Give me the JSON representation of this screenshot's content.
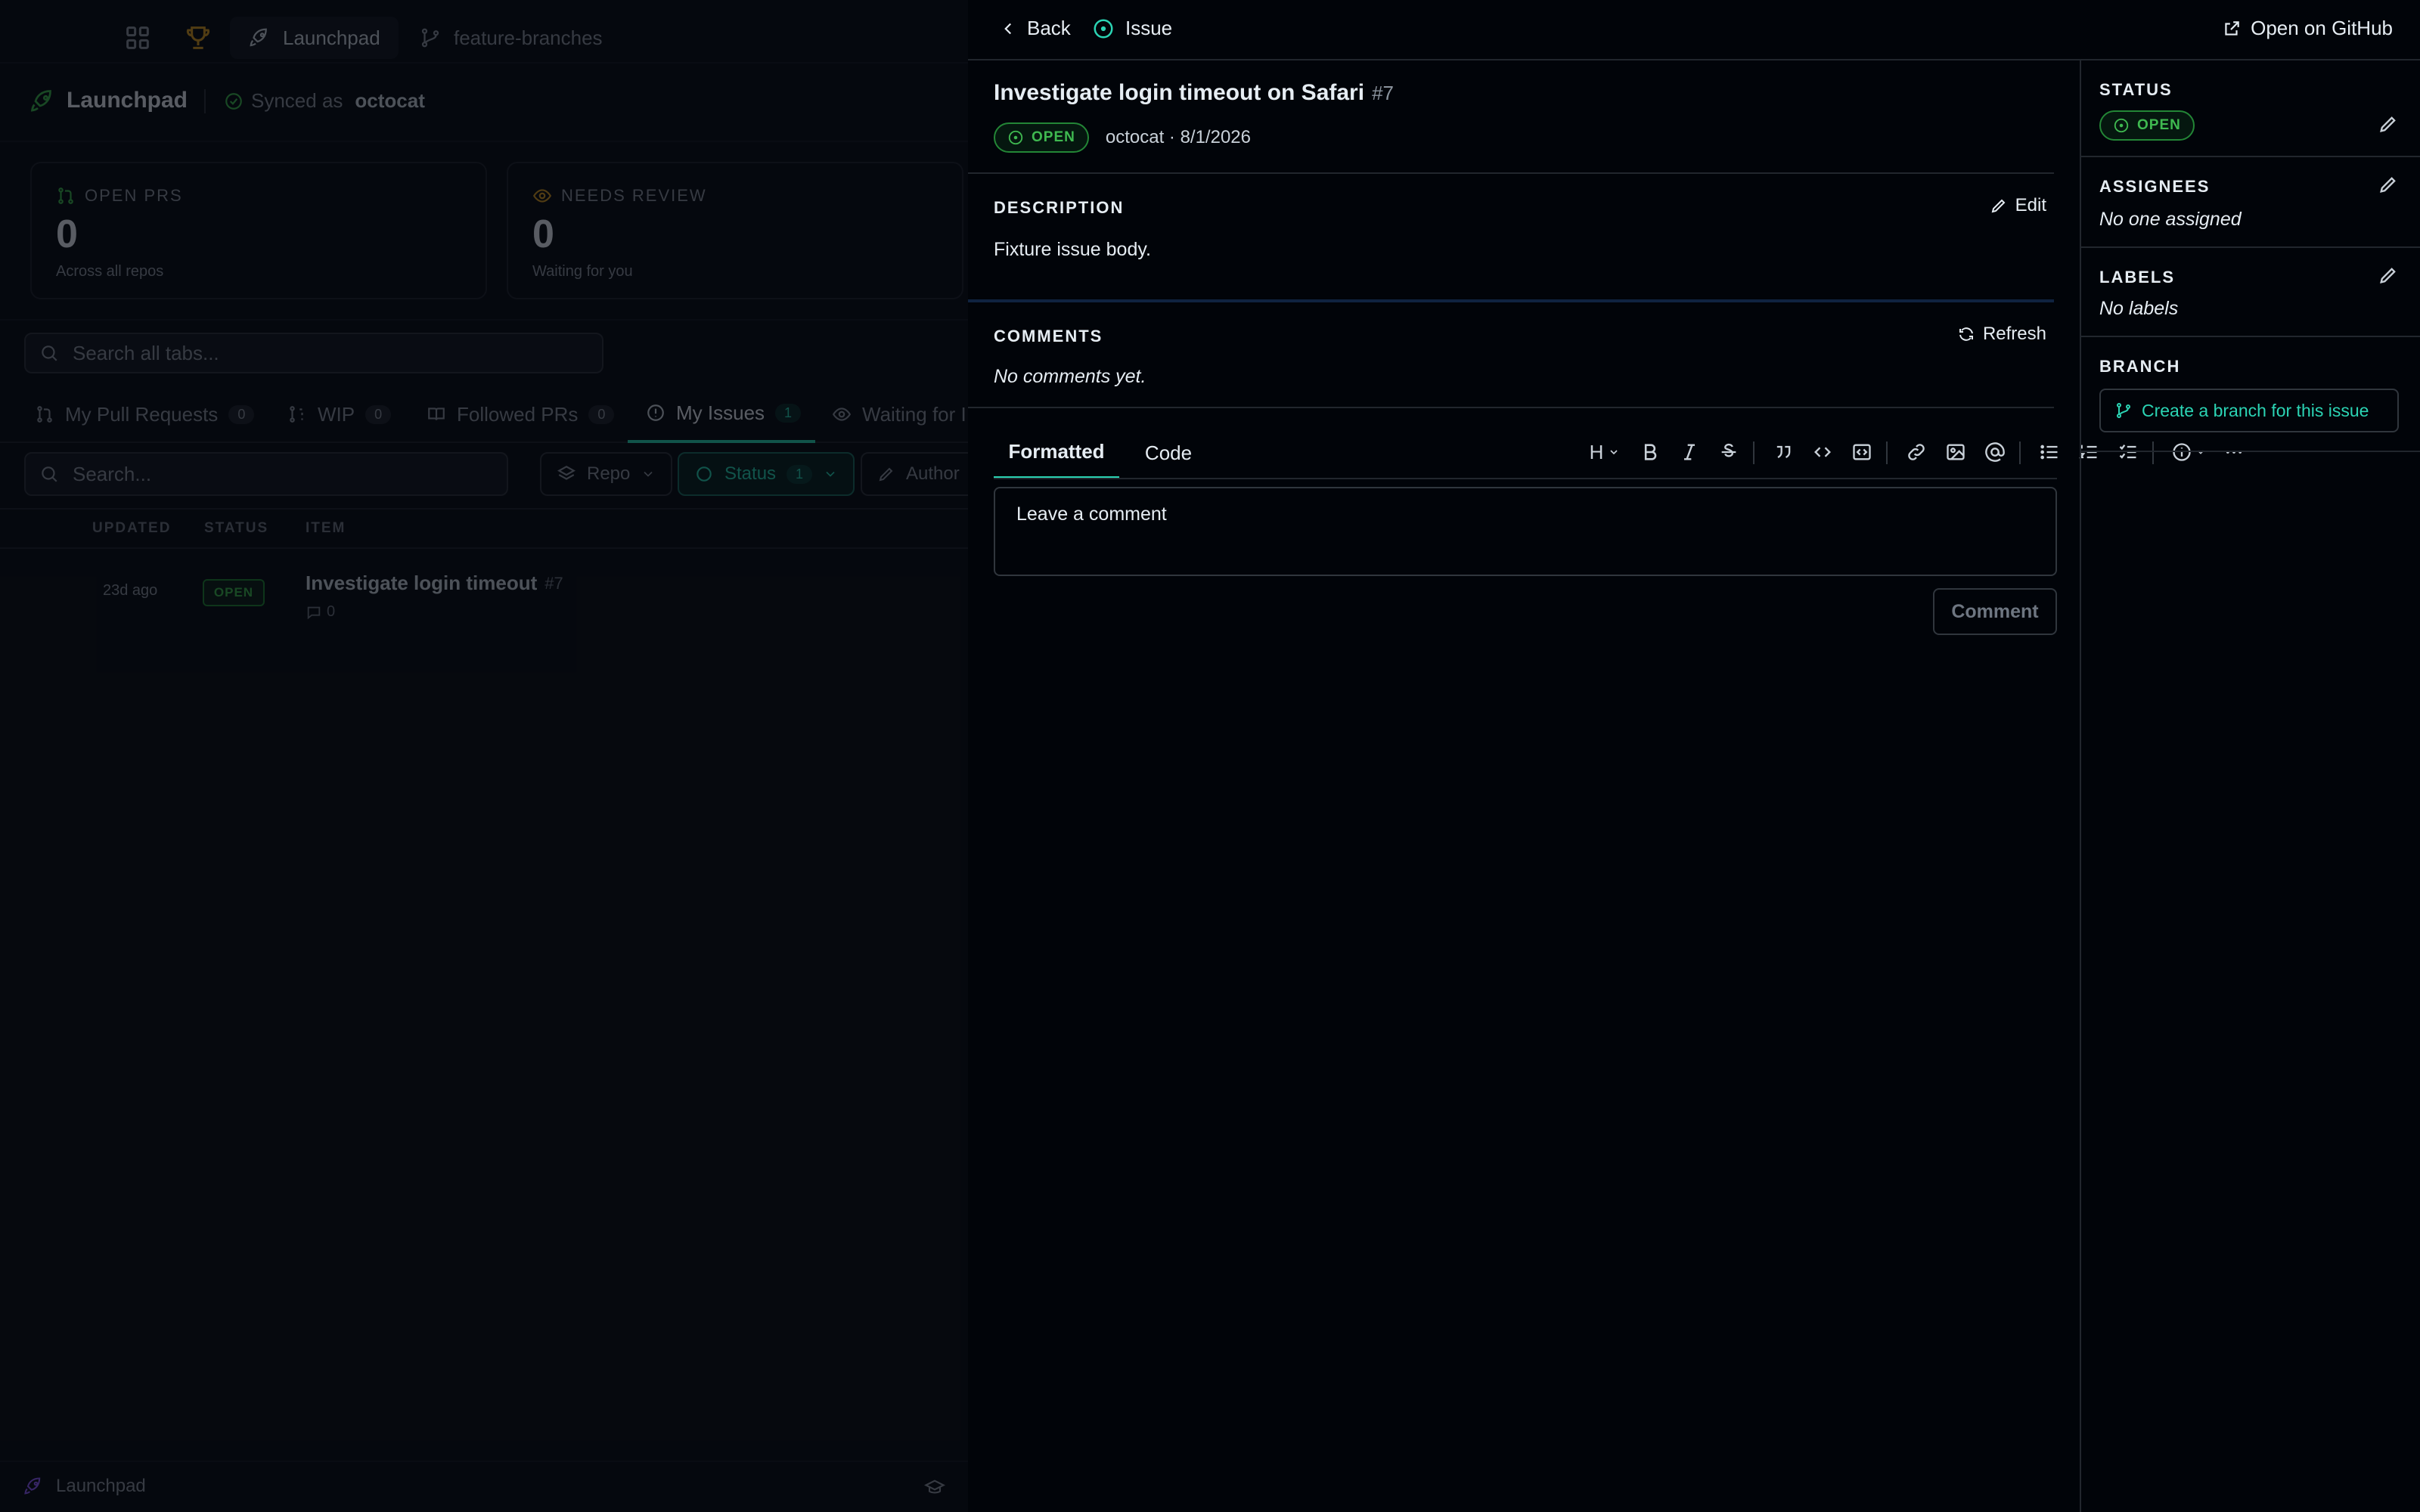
{
  "app": {
    "topbar_tabs": [
      {
        "label": "Launchpad",
        "icon": "rocket-icon"
      },
      {
        "label": "feature-branches",
        "icon": "git-branch-icon"
      }
    ],
    "header_title": "Launchpad",
    "synced_prefix": "Synced as",
    "synced_user": "octocat"
  },
  "stats": [
    {
      "label": "OPEN PRS",
      "value": "0",
      "sub": "Across all repos",
      "icon": "pull-request-icon",
      "color": "#3fb950"
    },
    {
      "label": "NEEDS REVIEW",
      "value": "0",
      "sub": "Waiting for you",
      "icon": "eye-icon",
      "color": "#d29922"
    }
  ],
  "search_all": {
    "placeholder": "Search all tabs..."
  },
  "tabs": [
    {
      "label": "My Pull Requests",
      "count": "0"
    },
    {
      "label": "WIP",
      "count": "0"
    },
    {
      "label": "Followed PRs",
      "count": "0"
    },
    {
      "label": "My Issues",
      "count": "1",
      "active": true
    },
    {
      "label": "Waiting for I"
    }
  ],
  "filter_bar": {
    "search_placeholder": "Search...",
    "repo": "Repo",
    "status": "Status",
    "status_count": "1",
    "author": "Author"
  },
  "table": {
    "headers": [
      "UPDATED",
      "STATUS",
      "ITEM"
    ],
    "rows": [
      {
        "updated": "23d ago",
        "status": "OPEN",
        "title": "Investigate login timeout",
        "number": "#7",
        "comments": "0"
      }
    ]
  },
  "footer": {
    "label": "Launchpad"
  },
  "panel": {
    "back": "Back",
    "type": "Issue",
    "open_github": "Open on GitHub",
    "title": "Investigate login timeout on Safari",
    "number": "#7",
    "state": "OPEN",
    "meta": "octocat · 8/1/2026",
    "description": {
      "heading": "DESCRIPTION",
      "edit": "Edit",
      "body": "Fixture issue body."
    },
    "comments": {
      "heading": "COMMENTS",
      "refresh": "Refresh",
      "empty": "No comments yet."
    },
    "editor": {
      "tab_formatted": "Formatted",
      "tab_code": "Code",
      "heading_btn": "H",
      "placeholder": "Leave a comment",
      "submit": "Comment"
    },
    "sidebar": {
      "status_heading": "STATUS",
      "status_value": "OPEN",
      "assignees_heading": "ASSIGNEES",
      "assignees_value": "No one assigned",
      "labels_heading": "LABELS",
      "labels_value": "No labels",
      "branch_heading": "BRANCH",
      "branch_button": "Create a branch for this issue"
    }
  },
  "colors": {
    "accent": "#2bd4b4",
    "open_green": "#3fb950",
    "warning": "#d29922"
  }
}
